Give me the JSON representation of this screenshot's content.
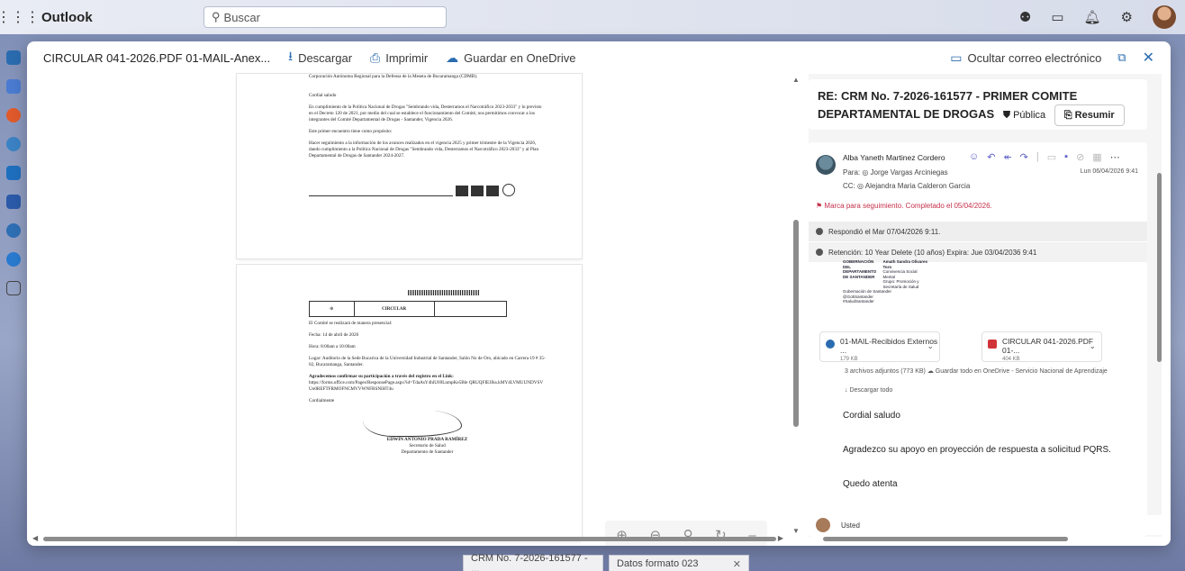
{
  "app": {
    "name": "Outlook",
    "search_placeholder": "Buscar"
  },
  "modal_header": {
    "filename": "CIRCULAR 041-2026.PDF 01-MAIL-Anex...",
    "download": "Descargar",
    "print": "Imprimir",
    "save_onedrive": "Guardar en OneDrive",
    "hide_email": "Ocultar correo electrónico"
  },
  "doc_page1": {
    "line1": "Corporación Autónoma Regional para la Defensa de la Meseta de Bucaramanga (CDMB).",
    "greeting": "Cordial saludo",
    "para1": "En cumplimiento de la Política Nacional de Drogas \"Sembrando vida, Desterramos el Narcotráfico 2023-2033\" y lo previsto en el Decreto 120 de 2021, por medio del cual se establece el funcionamiento del Comité, nos permitimos convocar a los integrantes del Comité Departamental de Drogas - Santander, Vigencia 2026.",
    "para2": "Este primer encuentro tiene como propósito:",
    "para3": "Hacer seguimiento a la información de los avances realizados en el vigencia 2025 y primer trimestre de la Vigencia 2026, dando cumplimiento a la Política Nacional de Drogas \"Sembrando vida, Desterramos el Narcotráfico 2023-2033\" y al Plan Departamental de Drogas de Santander 2024-2027."
  },
  "doc_page2": {
    "title": "CIRCULAR",
    "intro": "El Comité se realizará de manera presencial:",
    "fecha": "Fecha: 14 de abril de 2026",
    "hora": "Hora: 8:00am a 10:00am",
    "lugar": "Lugar: Auditorio de la Sede Bucarica de la Universidad Industrial de Santander, Salón No de Oro, ubicado en Carrera 19 # 35-02, Bucaramanga, Santander.",
    "agradec": "Agradecemos confirmar su participación a través del registro en el Link:",
    "link": "https://forms.office.com/Pages/ResponsePage.aspx?id=TdaAsY4hlU69LnmpKe5Ble QRUQFIEJJks.kMY4LVMUUNDVSVUo0REFTFRMOFNCMVVWNFBSNlHT4u",
    "closing": "Cordialmente",
    "signer": "EDWIN ANTONIO PRADA RAMÍREZ",
    "signer_title1": "Secretario de Salud",
    "signer_title2": "Departamento de Santander"
  },
  "email": {
    "subject": "RE: CRM No. 7-2026-161577 - PRIMER COMITE DEPARTAMENTAL DE DROGAS",
    "sensitivity": "Pública",
    "summarize": "Resumir",
    "sender": "Alba Yaneth Martinez Cordero",
    "to": "Para: ◎ Jorge Vargas Arciniegas",
    "cc": "CC: ◎ Alejandra Maria Calderon Garcia",
    "date": "Lun 06/04/2026 9:41",
    "flag": "Marca para seguimiento. Completado el 05/04/2026.",
    "replied": "Respondió el Mar 07/04/2026 9:11.",
    "retention": "Retención: 10 Year Delete (10 años) Expira: Jue 03/04/2036 9:41",
    "banner_lines": [
      "GOBERNACIÓN",
      "DEL DEPARTAMENTO",
      "DE SANTANDER",
      "Amath Sandra Olivares Toro",
      "Convivencia Social",
      "Mental",
      "Grupo: Promoción y",
      "Secretaría de Salud",
      "Gobernación de Santander",
      "@GobSantander",
      "#SaludSantander"
    ],
    "attachments": [
      {
        "name": "01-MAIL-Recibidos Externos ...",
        "size": "179 KB",
        "color": "#2b6cb0"
      },
      {
        "name": "CIRCULAR 041-2026.PDF 01-...",
        "size": "404 KB",
        "color": "#d13438"
      }
    ],
    "att_summary": "3 archivos adjuntos (773 KB)  ☁ Guardar todo en OneDrive - Servicio Nacional de Aprendizaje",
    "download_all": "↓  Descargar todo",
    "body": [
      "Cordial saludo",
      "Agradezco su apoyo en proyección de respuesta a solicitud PQRS.",
      "Quedo atenta"
    ],
    "reply_user": "Usted"
  },
  "taskbar": {
    "tab1": "CRM No. 7-2026-161577 - ...",
    "tab2": "Datos formato 023"
  }
}
